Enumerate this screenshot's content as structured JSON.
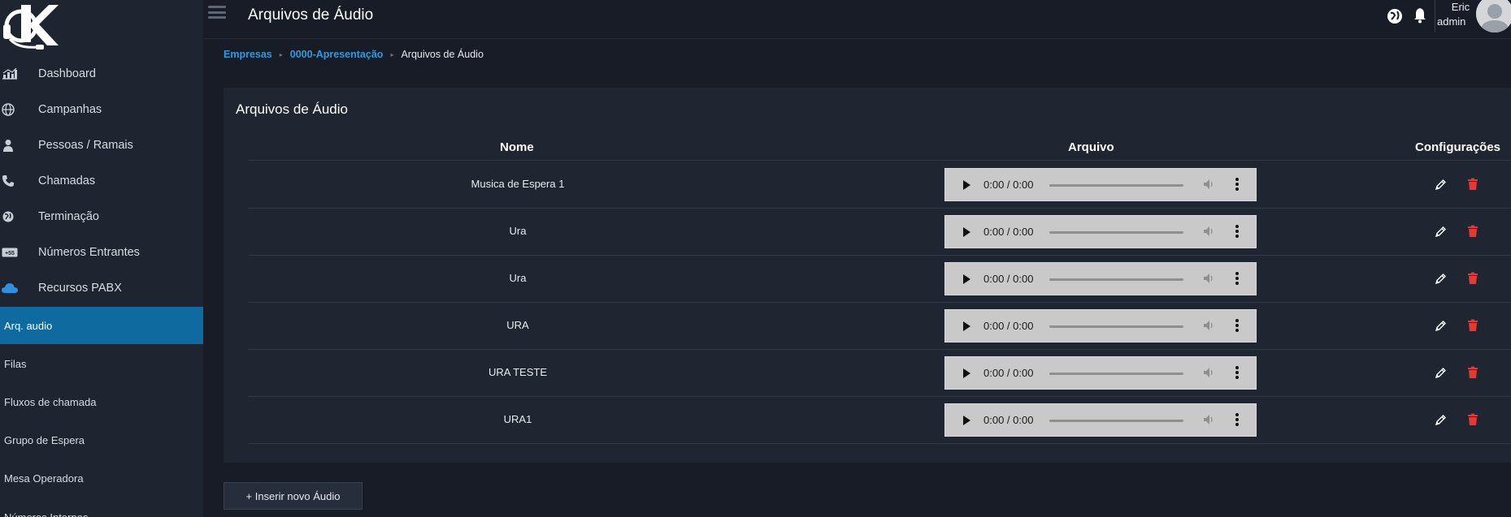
{
  "app": {
    "page_title": "Arquivos de Áudio"
  },
  "user": {
    "name": "Eric",
    "role": "admin"
  },
  "sidebar": {
    "items": [
      {
        "label": "Dashboard",
        "icon": "chart-bar-icon"
      },
      {
        "label": "Campanhas",
        "icon": "globe-icon"
      },
      {
        "label": "Pessoas / Ramais",
        "icon": "user-icon"
      },
      {
        "label": "Chamadas",
        "icon": "phone-icon"
      },
      {
        "label": "Terminação",
        "icon": "globe-pin-icon"
      },
      {
        "label": "Números Entrantes",
        "icon": "number-badge-icon"
      },
      {
        "label": "Recursos PABX",
        "icon": "cloud-icon"
      }
    ],
    "subitems": [
      {
        "label": "Arq. audio",
        "active": true
      },
      {
        "label": "Filas"
      },
      {
        "label": "Fluxos de chamada"
      },
      {
        "label": "Grupo de Espera"
      },
      {
        "label": "Mesa Operadora"
      },
      {
        "label": "Números Internos"
      }
    ]
  },
  "breadcrumb": {
    "items": [
      "Empresas",
      "0000-Apresentação"
    ],
    "current": "Arquivos de Áudio"
  },
  "card": {
    "title": "Arquivos de Áudio",
    "columns": {
      "name": "Nome",
      "file": "Arquivo",
      "config": "Configurações"
    },
    "rows": [
      {
        "name": "Musica de Espera 1",
        "time": "0:00 / 0:00"
      },
      {
        "name": "Ura",
        "time": "0:00 / 0:00"
      },
      {
        "name": "Ura",
        "time": "0:00 / 0:00"
      },
      {
        "name": "URA",
        "time": "0:00 / 0:00"
      },
      {
        "name": "URA TESTE",
        "time": "0:00 / 0:00"
      },
      {
        "name": "URA1",
        "time": "0:00 / 0:00"
      }
    ]
  },
  "actions": {
    "add_audio": "+ Inserir novo Áudio"
  },
  "colors": {
    "accent": "#0f6aa0",
    "link": "#2d9be0",
    "delete": "#e53935",
    "background": "#171c26",
    "panel": "#1f2531"
  }
}
